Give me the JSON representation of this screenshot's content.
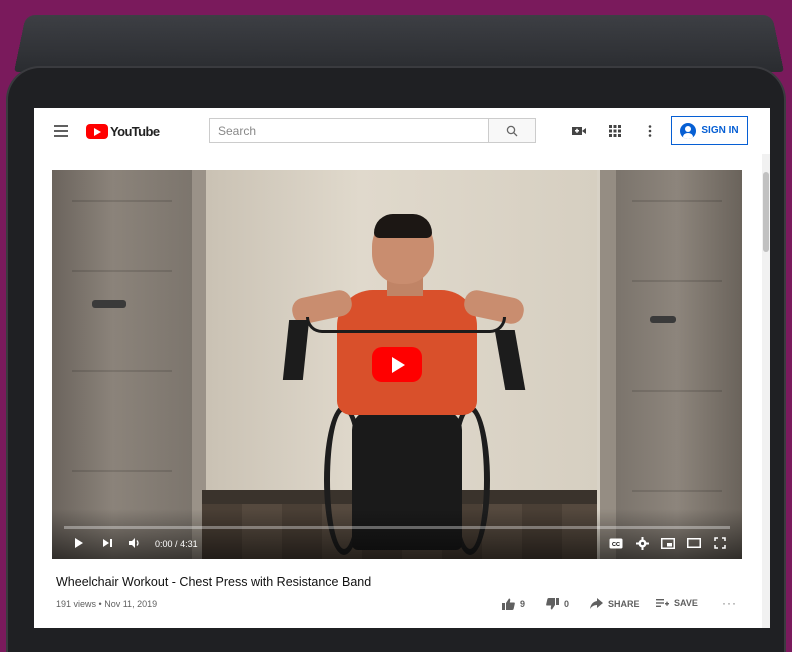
{
  "app": {
    "logo_text": "YouTube"
  },
  "masthead": {
    "search_placeholder": "Search",
    "sign_in_label": "SIGN IN"
  },
  "icons": {
    "menu": "hamburger-menu-icon",
    "search": "search-icon",
    "create": "video-camera-icon",
    "apps": "apps-grid-icon",
    "settings": "more-vertical-icon",
    "account": "account-circle-icon"
  },
  "player": {
    "current_time": "0:00",
    "duration": "4:31",
    "progress_fraction": 0
  },
  "video": {
    "title": "Wheelchair Workout - Chest Press with Resistance Band",
    "views": "191 views",
    "separator": "•",
    "date": "Nov 11, 2019",
    "likes": "9",
    "dislikes": "0",
    "share_label": "SHARE",
    "save_label": "SAVE"
  },
  "colors": {
    "background": "#7a1a5c",
    "brand_red": "#ff0000",
    "sign_in_blue": "#065fd4"
  }
}
